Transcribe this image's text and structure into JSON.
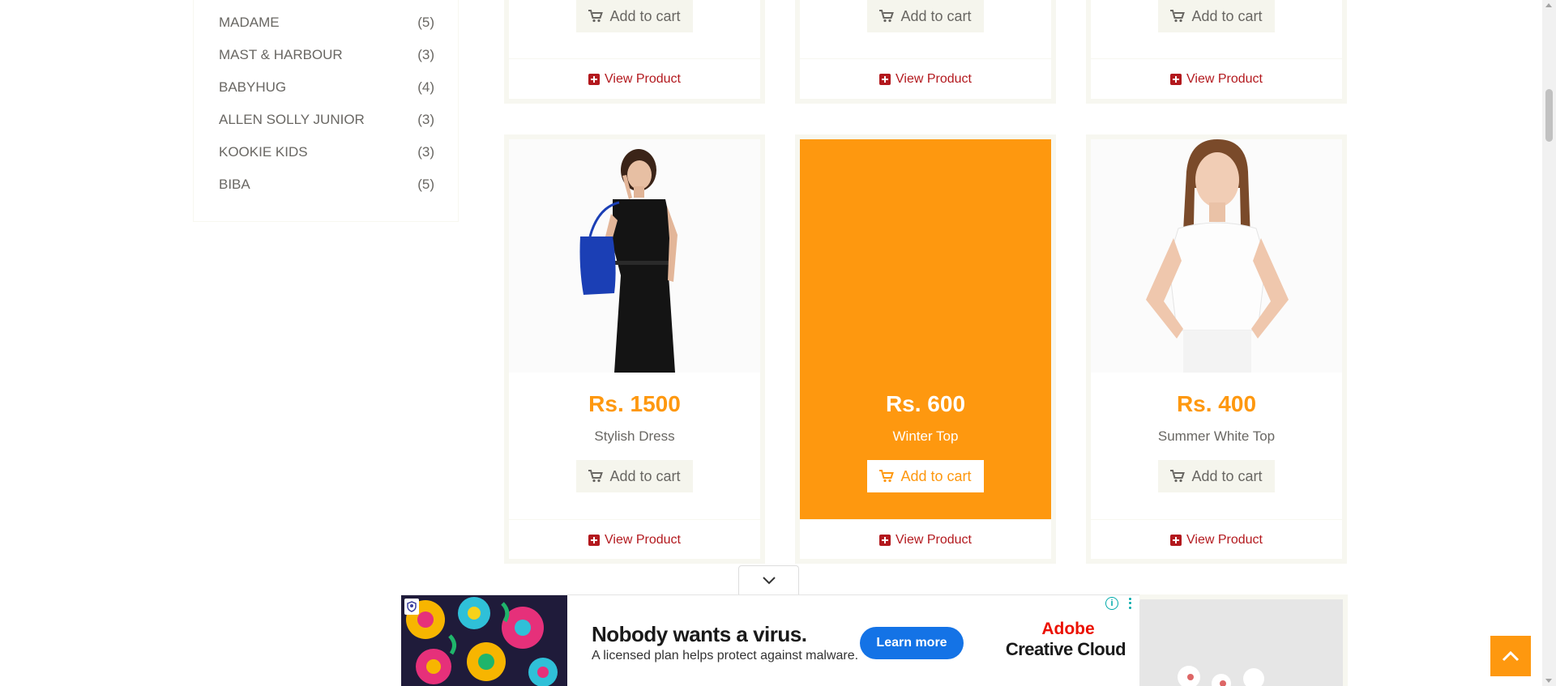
{
  "brands": [
    {
      "name": "MADAME",
      "count": "(5)"
    },
    {
      "name": "MAST & HARBOUR",
      "count": "(3)"
    },
    {
      "name": "BABYHUG",
      "count": "(4)"
    },
    {
      "name": "ALLEN SOLLY JUNIOR",
      "count": "(3)"
    },
    {
      "name": "KOOKIE KIDS",
      "count": "(3)"
    },
    {
      "name": "BIBA",
      "count": "(5)"
    }
  ],
  "top_row": {
    "add_to_cart": "Add to cart",
    "view_product": "View Product"
  },
  "products": [
    {
      "price": "Rs. 1500",
      "name": "Stylish Dress",
      "add_to_cart": "Add to cart",
      "view_product": "View Product",
      "image": "woman-black-dress-photo"
    },
    {
      "price": "Rs. 600",
      "name": "Winter Top",
      "add_to_cart": "Add to cart",
      "view_product": "View Product",
      "image": "winter-top-photo"
    },
    {
      "price": "Rs. 400",
      "name": "Summer White Top",
      "add_to_cart": "Add to cart",
      "view_product": "View Product",
      "image": "woman-white-top-photo"
    }
  ],
  "ad": {
    "headline": "Nobody wants a virus.",
    "subtext": "A licensed plan helps protect against malware.",
    "cta": "Learn more",
    "brand_line1": "Adobe",
    "brand_line2": "Creative Cloud",
    "info": "i"
  },
  "colors": {
    "accent": "#fe980f",
    "link": "#b3191e",
    "ad_button": "#1473e6",
    "adobe_red": "#eb1000"
  }
}
